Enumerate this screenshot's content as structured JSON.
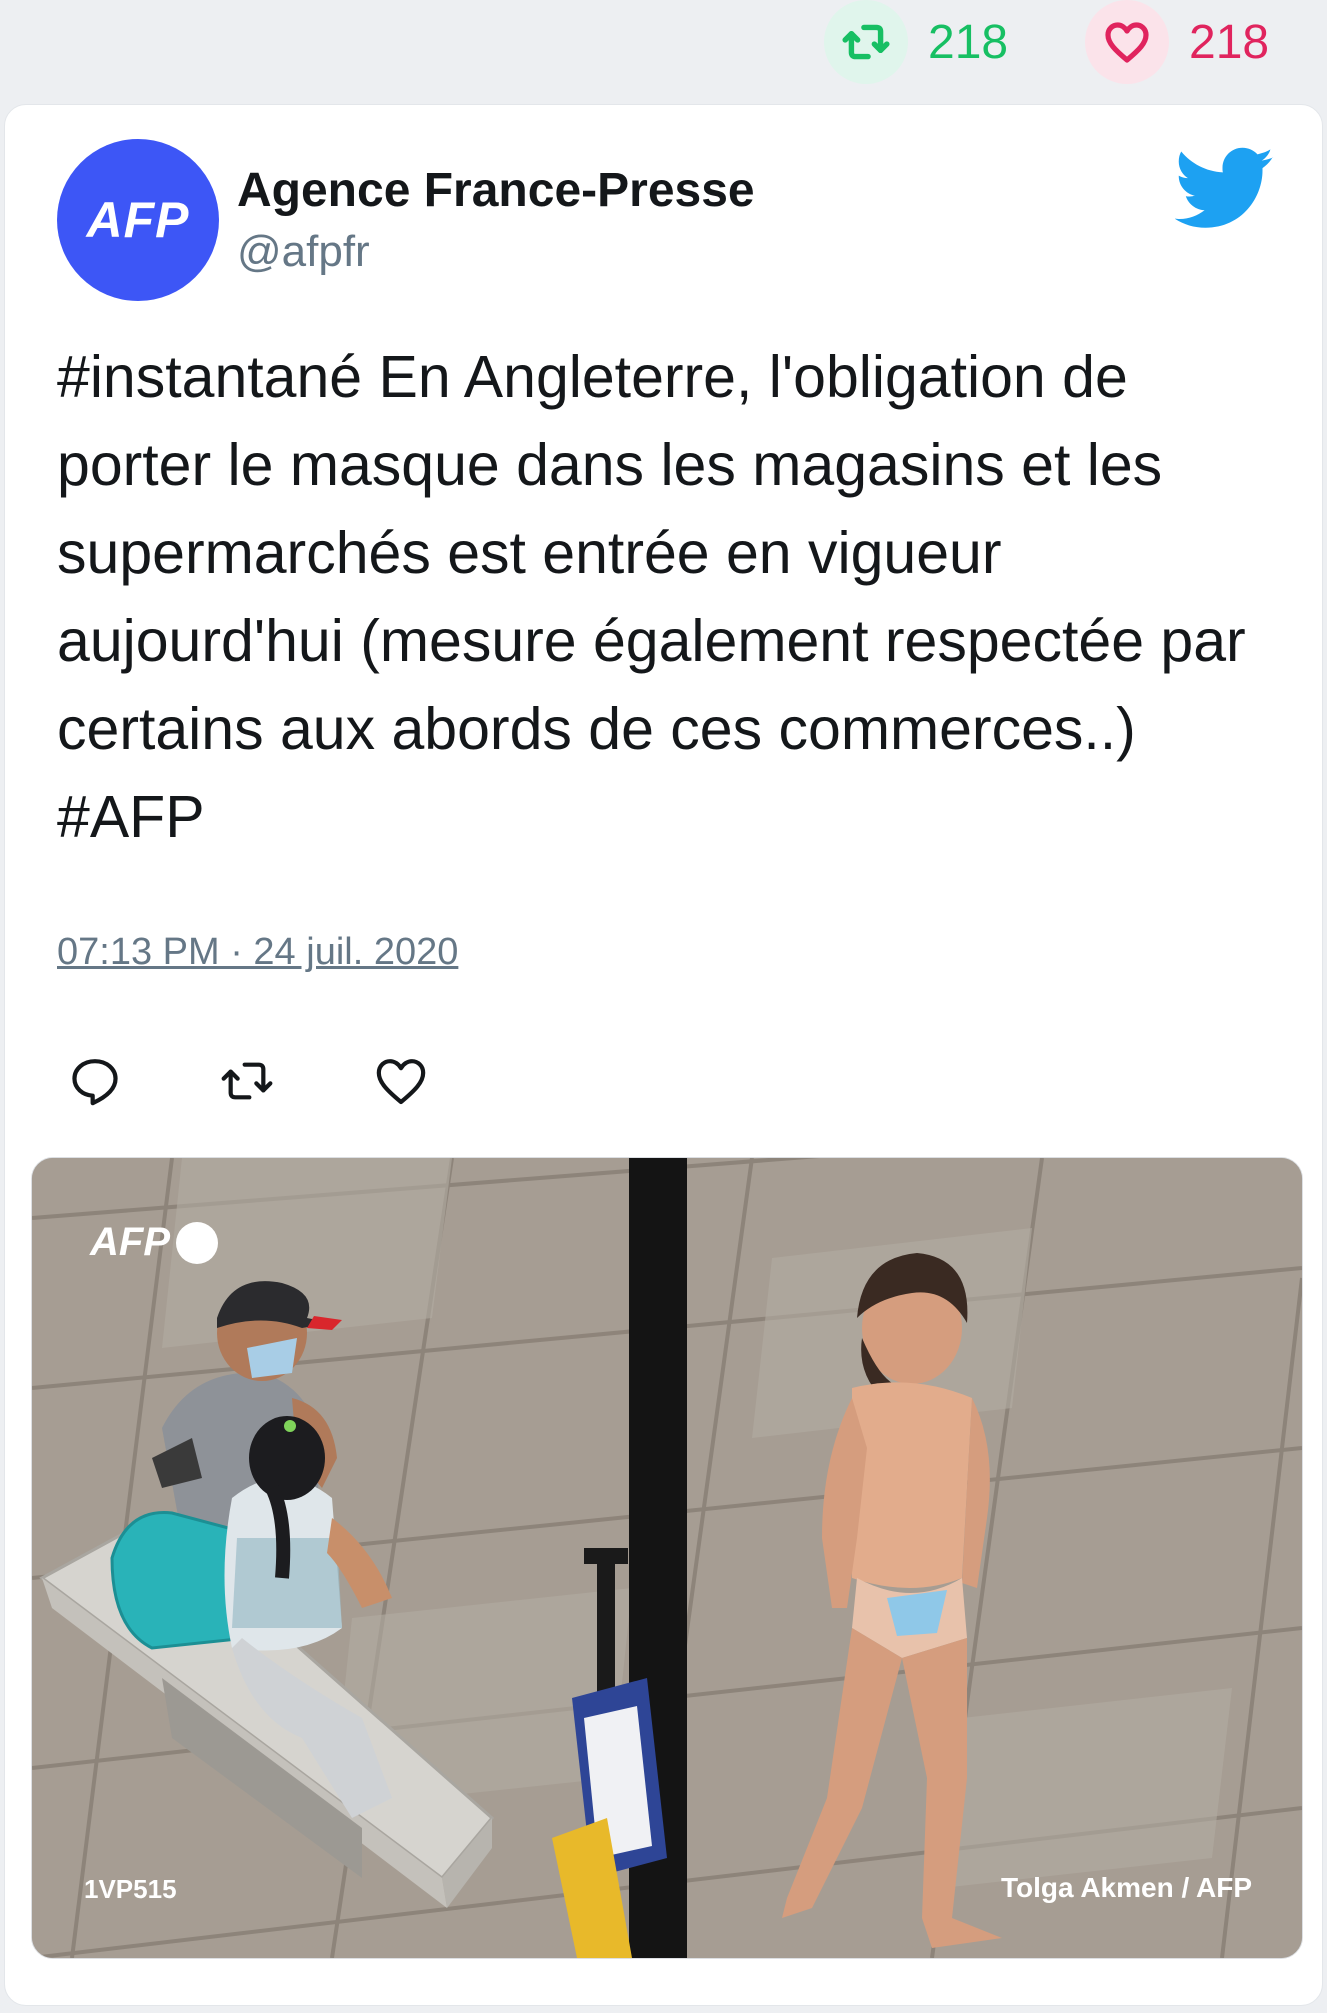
{
  "stats": {
    "retweets": "218",
    "likes": "218",
    "retweet_color": "#17bf63",
    "like_color": "#e0245e"
  },
  "tweet": {
    "author_name": "Agence France-Presse",
    "author_handle": "@afpfr",
    "avatar_text": "AFP",
    "avatar_color": "#3d56f6",
    "text": "#instantané En Angleterre, l'obligation de porter le masque dans les magasins et les supermarchés est entrée en vigueur aujourd'hui (mesure également respectée par certains aux abords de ces commerces..) #AFP",
    "timestamp": "07:13 PM · 24 juil. 2020",
    "platform_icon": "twitter-bird-icon"
  },
  "actions": [
    {
      "name": "reply",
      "icon": "reply-icon"
    },
    {
      "name": "retweet",
      "icon": "retweet-icon"
    },
    {
      "name": "like",
      "icon": "heart-icon"
    }
  ],
  "photo": {
    "watermark": "AFP",
    "code": "1VP515",
    "credit": "Tolga Akmen / AFP"
  }
}
